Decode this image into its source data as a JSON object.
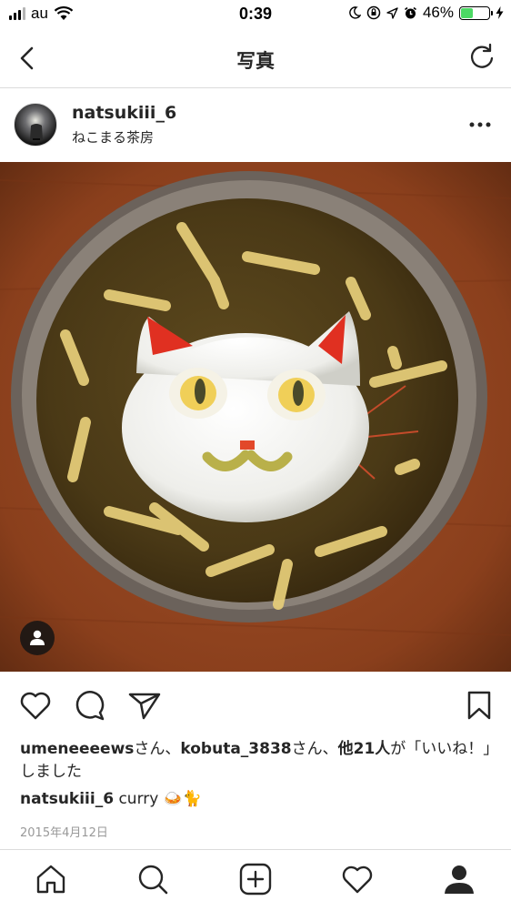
{
  "status_bar": {
    "carrier": "au",
    "time": "0:39",
    "battery_percent": "46%",
    "battery_level": 0.46,
    "icons": [
      "signal-icon",
      "wifi-icon",
      "moon-icon",
      "rotation-lock-icon",
      "location-icon",
      "alarm-icon",
      "battery-icon",
      "charging-icon"
    ]
  },
  "nav": {
    "title": "写真",
    "back_icon": "back-chevron-icon",
    "refresh_icon": "refresh-icon"
  },
  "post": {
    "username": "natsukiii_6",
    "location": "ねこまる茶房",
    "more_icon": "more-icon",
    "photo_alt": "cat-shaped rice curry",
    "user_tag_icon": "user-tag-icon"
  },
  "actions": {
    "icons": [
      "heart-icon",
      "comment-icon",
      "share-icon",
      "bookmark-icon"
    ]
  },
  "likes": {
    "user1": "umeneeeews",
    "suffix1": "さん、",
    "user2": "kobuta_3838",
    "suffix2": "さん、",
    "others": "他21人",
    "rest": "が「いいね！」しました"
  },
  "caption": {
    "username": "natsukiii_6",
    "text": "curry 🍛🐈"
  },
  "date": "2015年4月12日",
  "tabbar": {
    "icons": [
      "home-icon",
      "search-icon",
      "add-post-icon",
      "activity-heart-icon",
      "profile-icon"
    ]
  },
  "colors": {
    "text": "#262626",
    "muted": "#999999",
    "divider": "#dbdbdb",
    "battery_green": "#4cd964"
  }
}
